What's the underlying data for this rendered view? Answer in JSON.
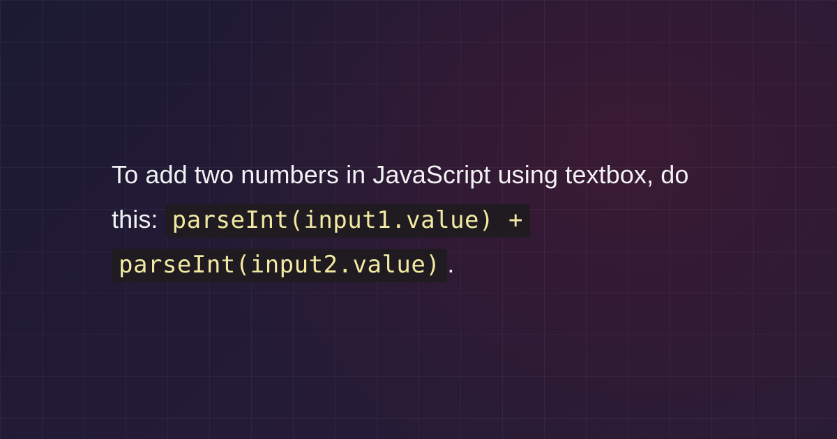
{
  "text": {
    "intro": "To add two numbers in JavaScript using textbox, do this: ",
    "code_line1": "parseInt(input1.value) +",
    "code_line2": "parseInt(input2.value)",
    "outro": "."
  }
}
